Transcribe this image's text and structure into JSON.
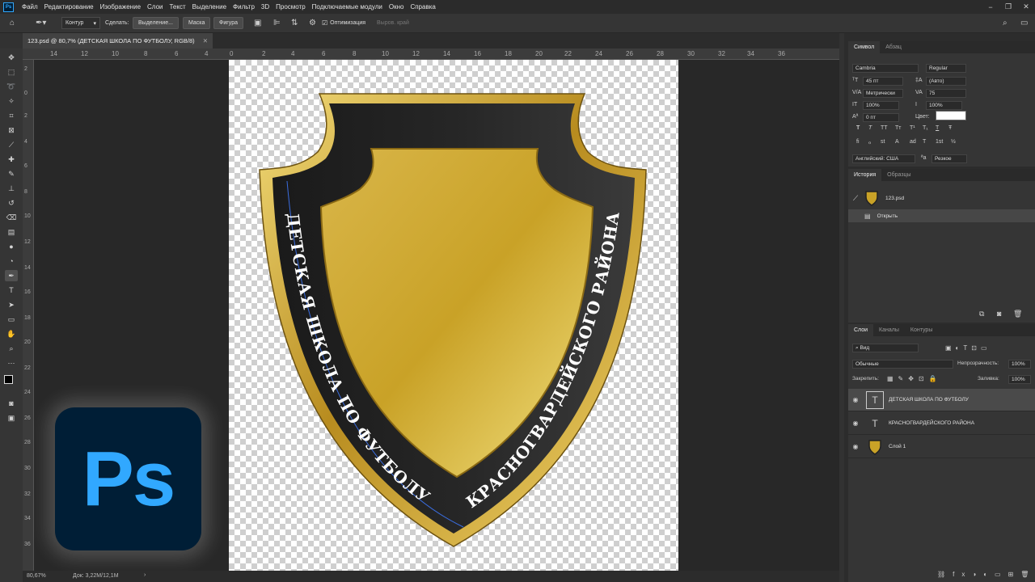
{
  "menubar": {
    "items": [
      "Файл",
      "Редактирование",
      "Изображение",
      "Слои",
      "Текст",
      "Выделение",
      "Фильтр",
      "3D",
      "Просмотр",
      "Подключаемые модули",
      "Окно",
      "Справка"
    ]
  },
  "options": {
    "mode": "Контур",
    "make_label": "Сделать:",
    "selection_btn": "Выделение...",
    "mask_btn": "Маска",
    "shape_btn": "Фигура",
    "optimize_label": "Оптимизация",
    "align_label": "Выров. край"
  },
  "document": {
    "tab_title": "123.psd @ 80,7% (ДЕТСКАЯ ШКОЛА ПО ФУТБОЛУ, RGB/8)",
    "zoom": "80,67%",
    "doc_info": "Док: 3,22M/12,1M"
  },
  "ruler": {
    "top": [
      "14",
      "12",
      "10",
      "8",
      "6",
      "4",
      "2",
      "0",
      "2",
      "4",
      "6",
      "8",
      "10",
      "12",
      "14",
      "16",
      "18",
      "20",
      "22",
      "24",
      "26",
      "28",
      "30",
      "32",
      "34",
      "36"
    ],
    "left": [
      "2",
      "0",
      "2",
      "4",
      "6",
      "8",
      "10",
      "12",
      "14",
      "16",
      "18",
      "20",
      "22",
      "24",
      "26",
      "28",
      "30",
      "32",
      "34",
      "36"
    ]
  },
  "badge": {
    "top_text": "ДЕТСКАЯ ШКОЛА ПО ФУТБОЛУ",
    "bottom_text": "КРАСНОГВАРДЕЙСКОГО РАЙОНА"
  },
  "character_panel": {
    "tabs": [
      "Символ",
      "Абзац"
    ],
    "font": "Cambria",
    "style": "Regular",
    "size": "45 пт",
    "leading": "(Авто)",
    "kerning": "Метрически",
    "tracking": "75",
    "vscale": "100%",
    "hscale": "100%",
    "baseline": "0 пт",
    "color_label": "Цвет:",
    "language": "Английский: США",
    "aa": "Резкое",
    "style_buttons": [
      "T",
      "T",
      "TT",
      "Tт",
      "T¹",
      "T₁",
      "T",
      "Ŧ"
    ],
    "ot_buttons": [
      "fi",
      "ℴ",
      "st",
      "A",
      "ad",
      "T",
      "1st",
      "½"
    ]
  },
  "history_panel": {
    "tabs": [
      "История",
      "Образцы"
    ],
    "snapshot": "123.psd",
    "items": [
      "Открыть"
    ]
  },
  "layers_panel": {
    "tabs": [
      "Слои",
      "Каналы",
      "Контуры"
    ],
    "filter": "Вид",
    "blend": "Обычные",
    "opacity_label": "Непрозрачность:",
    "opacity": "100%",
    "lock_label": "Закрепить:",
    "fill_label": "Заливка:",
    "fill": "100%",
    "layers": [
      {
        "name": "ДЕТСКАЯ ШКОЛА ПО ФУТБОЛУ",
        "type": "text"
      },
      {
        "name": "КРАСНОГВАРДЕЙСКОГО РАЙОНА",
        "type": "text"
      },
      {
        "name": "Слой 1",
        "type": "image"
      }
    ]
  },
  "logo": {
    "text": "Ps"
  },
  "colors": {
    "accent": "#31a8ff",
    "logo_bg": "#001e36",
    "gold": "#c9a227"
  }
}
